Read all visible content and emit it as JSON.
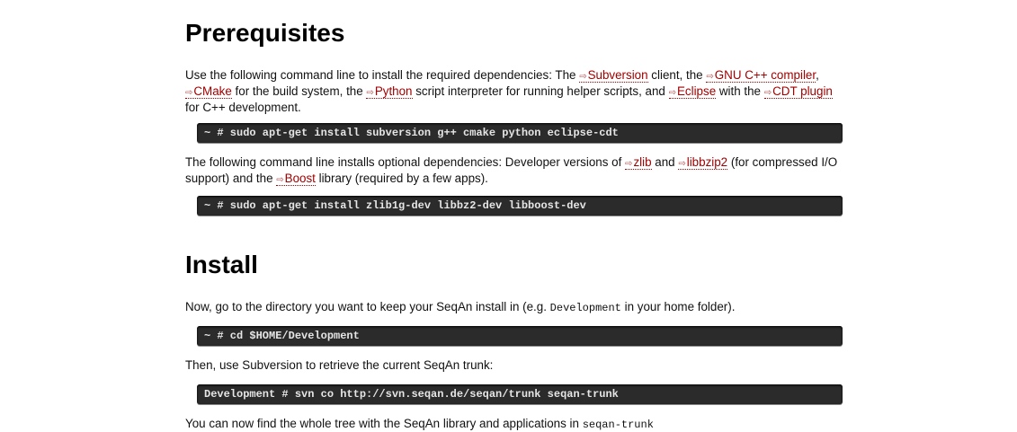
{
  "sections": {
    "prereq": {
      "title": "Prerequisites",
      "intro": {
        "t1": "Use the following command line to install the required dependencies: The ",
        "link_subversion": "Subversion",
        "t2": " client, the ",
        "link_gnu": "GNU C++ compiler",
        "t3": ", ",
        "link_cmake": "CMake",
        "t4": " for the build system, the ",
        "link_python": "Python",
        "t5": " script interpreter for running helper scripts, and ",
        "link_eclipse": "Eclipse",
        "t6": " with the ",
        "link_cdt": "CDT plugin",
        "t7": " for C++ development."
      },
      "cmd1": "~ # sudo apt-get install subversion g++ cmake python eclipse-cdt",
      "optional": {
        "t1": "The following command line installs optional dependencies: Developer versions of ",
        "link_zlib": "zlib",
        "t2": " and ",
        "link_libbzip2": "libbzip2",
        "t3": " (for compressed I/O support) and the ",
        "link_boost": "Boost",
        "t4": " library (required by a few apps)."
      },
      "cmd2": "~ # sudo apt-get install zlib1g-dev libbz2-dev libboost-dev"
    },
    "install": {
      "title": "Install",
      "p1": {
        "t1": "Now, go to the directory you want to keep your SeqAn install in (e.g. ",
        "code": "Development",
        "t2": " in your home folder)."
      },
      "cmd3": "~ # cd $HOME/Development",
      "p2": "Then, use Subversion to retrieve the current SeqAn trunk:",
      "cmd4": "Development # svn co http://svn.seqan.de/seqan/trunk seqan-trunk",
      "p3": {
        "t1": "You can now find the whole tree with the SeqAn library and applications in ",
        "code": "seqan-trunk"
      }
    }
  },
  "icons": {
    "external_link": "external-link-icon"
  },
  "colors": {
    "link": "#a20000",
    "command_bg": "#2b2b2b",
    "command_text": "#e6e6e6"
  }
}
